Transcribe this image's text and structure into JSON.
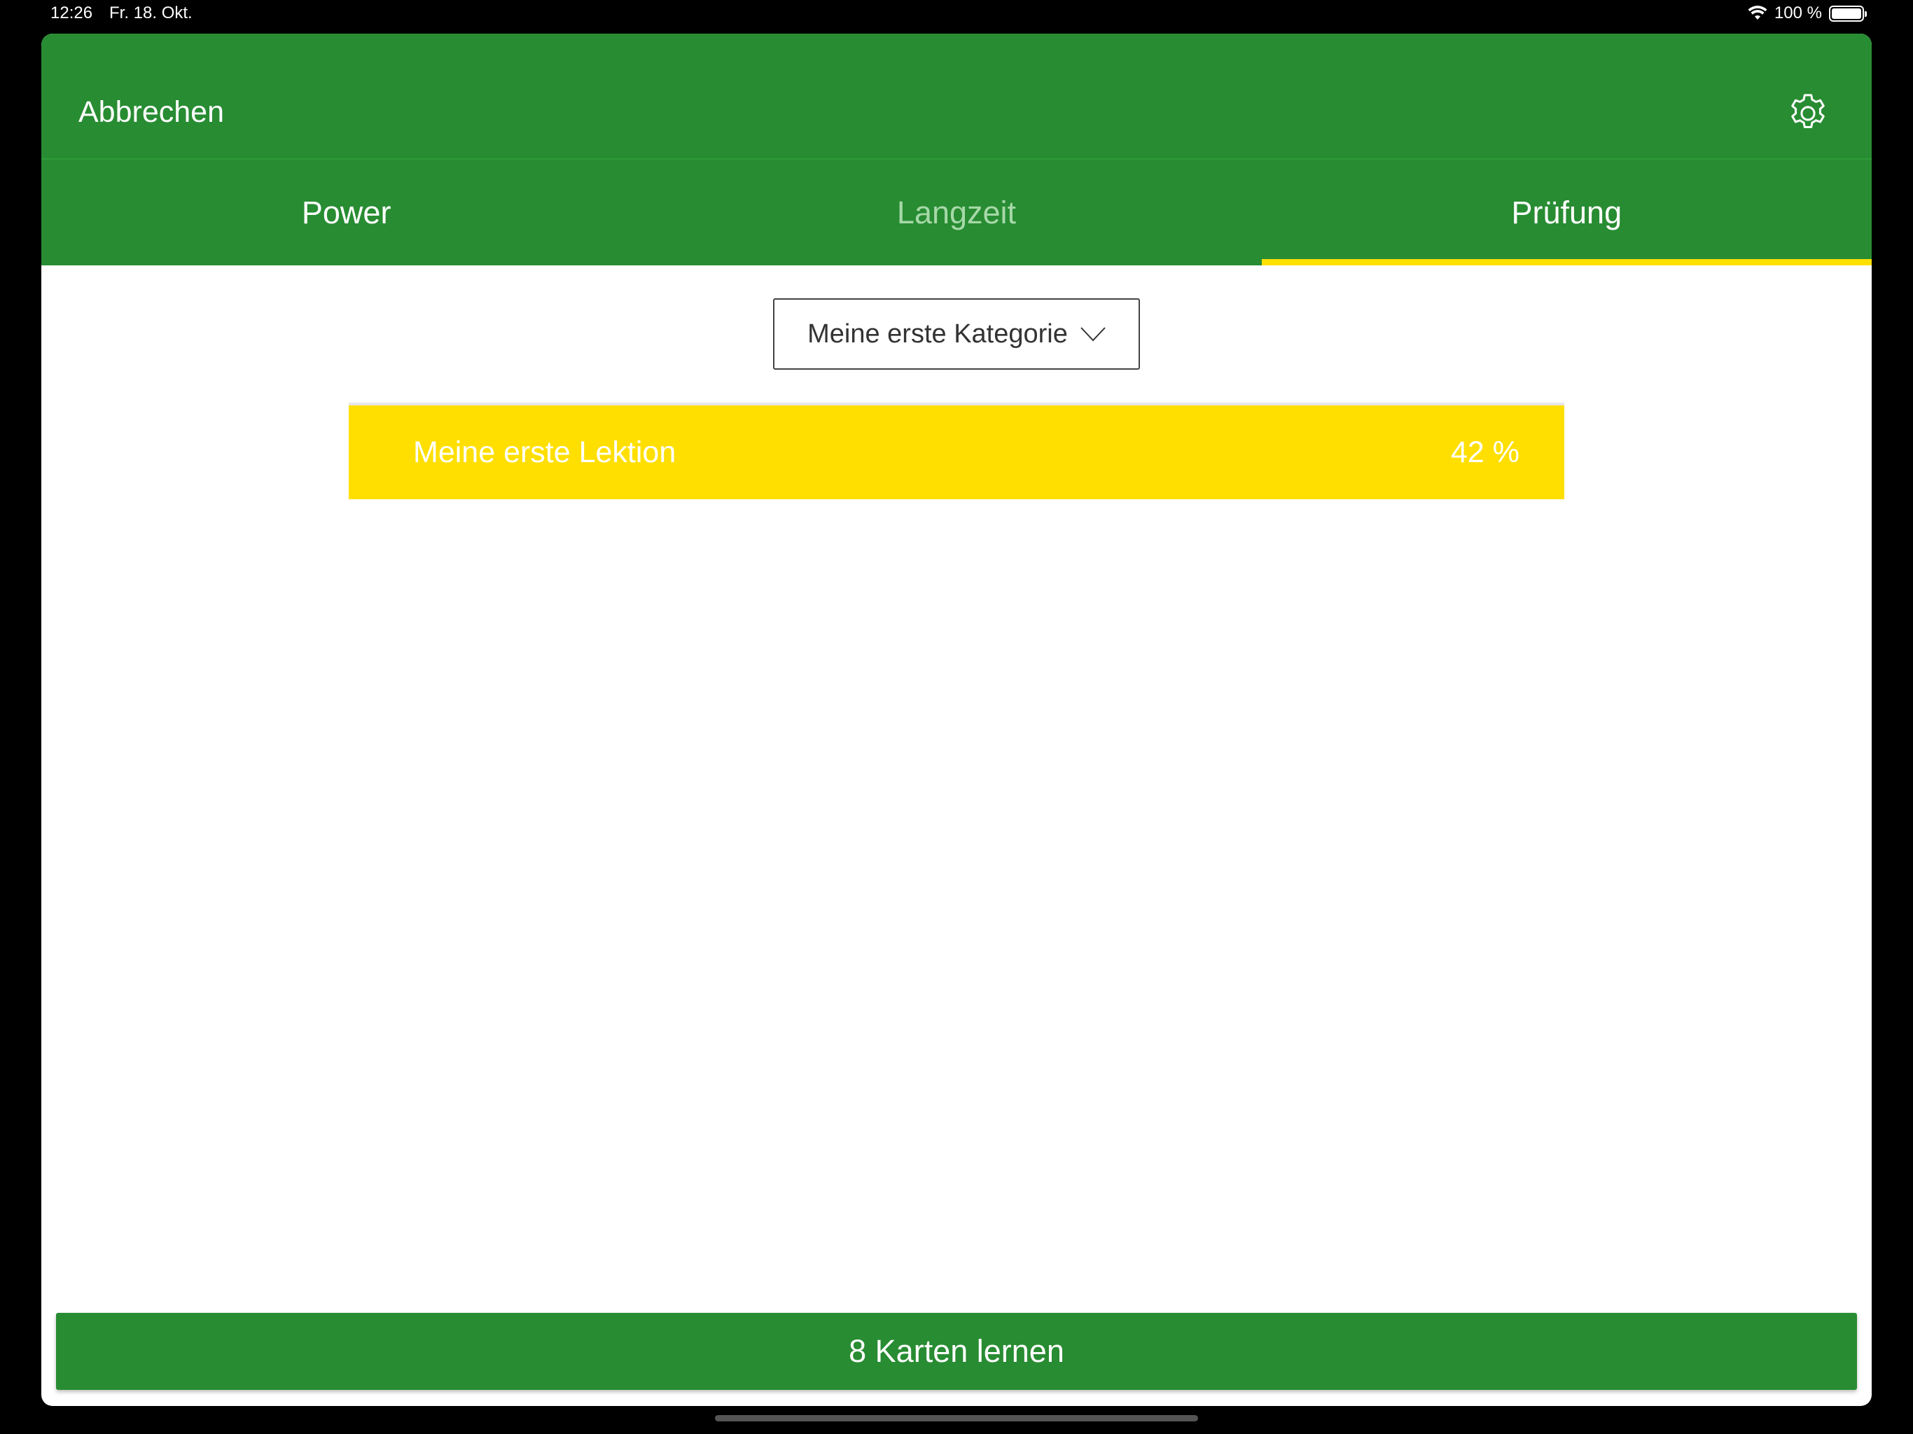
{
  "status_bar": {
    "time": "12:26",
    "date": "Fr. 18. Okt.",
    "battery": "100 %",
    "icons": [
      "wifi-icon",
      "battery-icon"
    ]
  },
  "header": {
    "cancel_label": "Abbrechen",
    "settings_icon": "gear-icon"
  },
  "tabs": [
    {
      "label": "Power",
      "active": false
    },
    {
      "label": "Langzeit",
      "active": false
    },
    {
      "label": "Prüfung",
      "active": true
    }
  ],
  "category": {
    "selected": "Meine erste Kategorie",
    "icon": "chevron-down-icon"
  },
  "lessons": [
    {
      "title": "Meine erste Lektion",
      "percent": "42 %"
    }
  ],
  "footer": {
    "learn_label": "8 Karten lernen"
  },
  "colors": {
    "primary_green": "#288c32",
    "accent_yellow": "#ffdf00",
    "tab_inactive": "#a6d8a8"
  }
}
